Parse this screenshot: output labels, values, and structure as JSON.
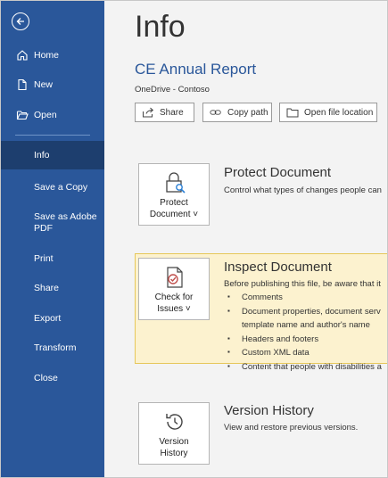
{
  "sidebar": {
    "items": [
      {
        "label": "Home",
        "icon": "home-icon"
      },
      {
        "label": "New",
        "icon": "new-document-icon"
      },
      {
        "label": "Open",
        "icon": "folder-open-icon"
      },
      {
        "label": "Info"
      },
      {
        "label": "Save a Copy"
      },
      {
        "label": "Save as Adobe PDF"
      },
      {
        "label": "Print"
      },
      {
        "label": "Share"
      },
      {
        "label": "Export"
      },
      {
        "label": "Transform"
      },
      {
        "label": "Close"
      }
    ],
    "active": "Info"
  },
  "main": {
    "title": "Info",
    "document_name": "CE Annual Report",
    "location": "OneDrive - Contoso",
    "buttons": {
      "share": "Share",
      "copy_path": "Copy path",
      "open_location": "Open file location"
    },
    "protect": {
      "tile_line1": "Protect",
      "tile_line2": "Document ˅",
      "heading": "Protect Document",
      "description": "Control what types of changes people can"
    },
    "inspect": {
      "tile_line1": "Check for",
      "tile_line2": "Issues ˅",
      "heading": "Inspect Document",
      "description": "Before publishing this file, be aware that it",
      "bullets": [
        "Comments",
        "Document properties, document serv",
        "template name and author's name",
        "Headers and footers",
        "Custom XML data",
        "Content that people with disabilities a"
      ]
    },
    "version": {
      "tile_line1": "Version",
      "tile_line2": "History",
      "heading": "Version History",
      "description": "View and restore previous versions."
    }
  },
  "colors": {
    "sidebar_bg": "#2a579a",
    "sidebar_active": "#1d3e6e",
    "accent_text": "#2a579a",
    "highlight_bg": "#fcf2cf"
  }
}
